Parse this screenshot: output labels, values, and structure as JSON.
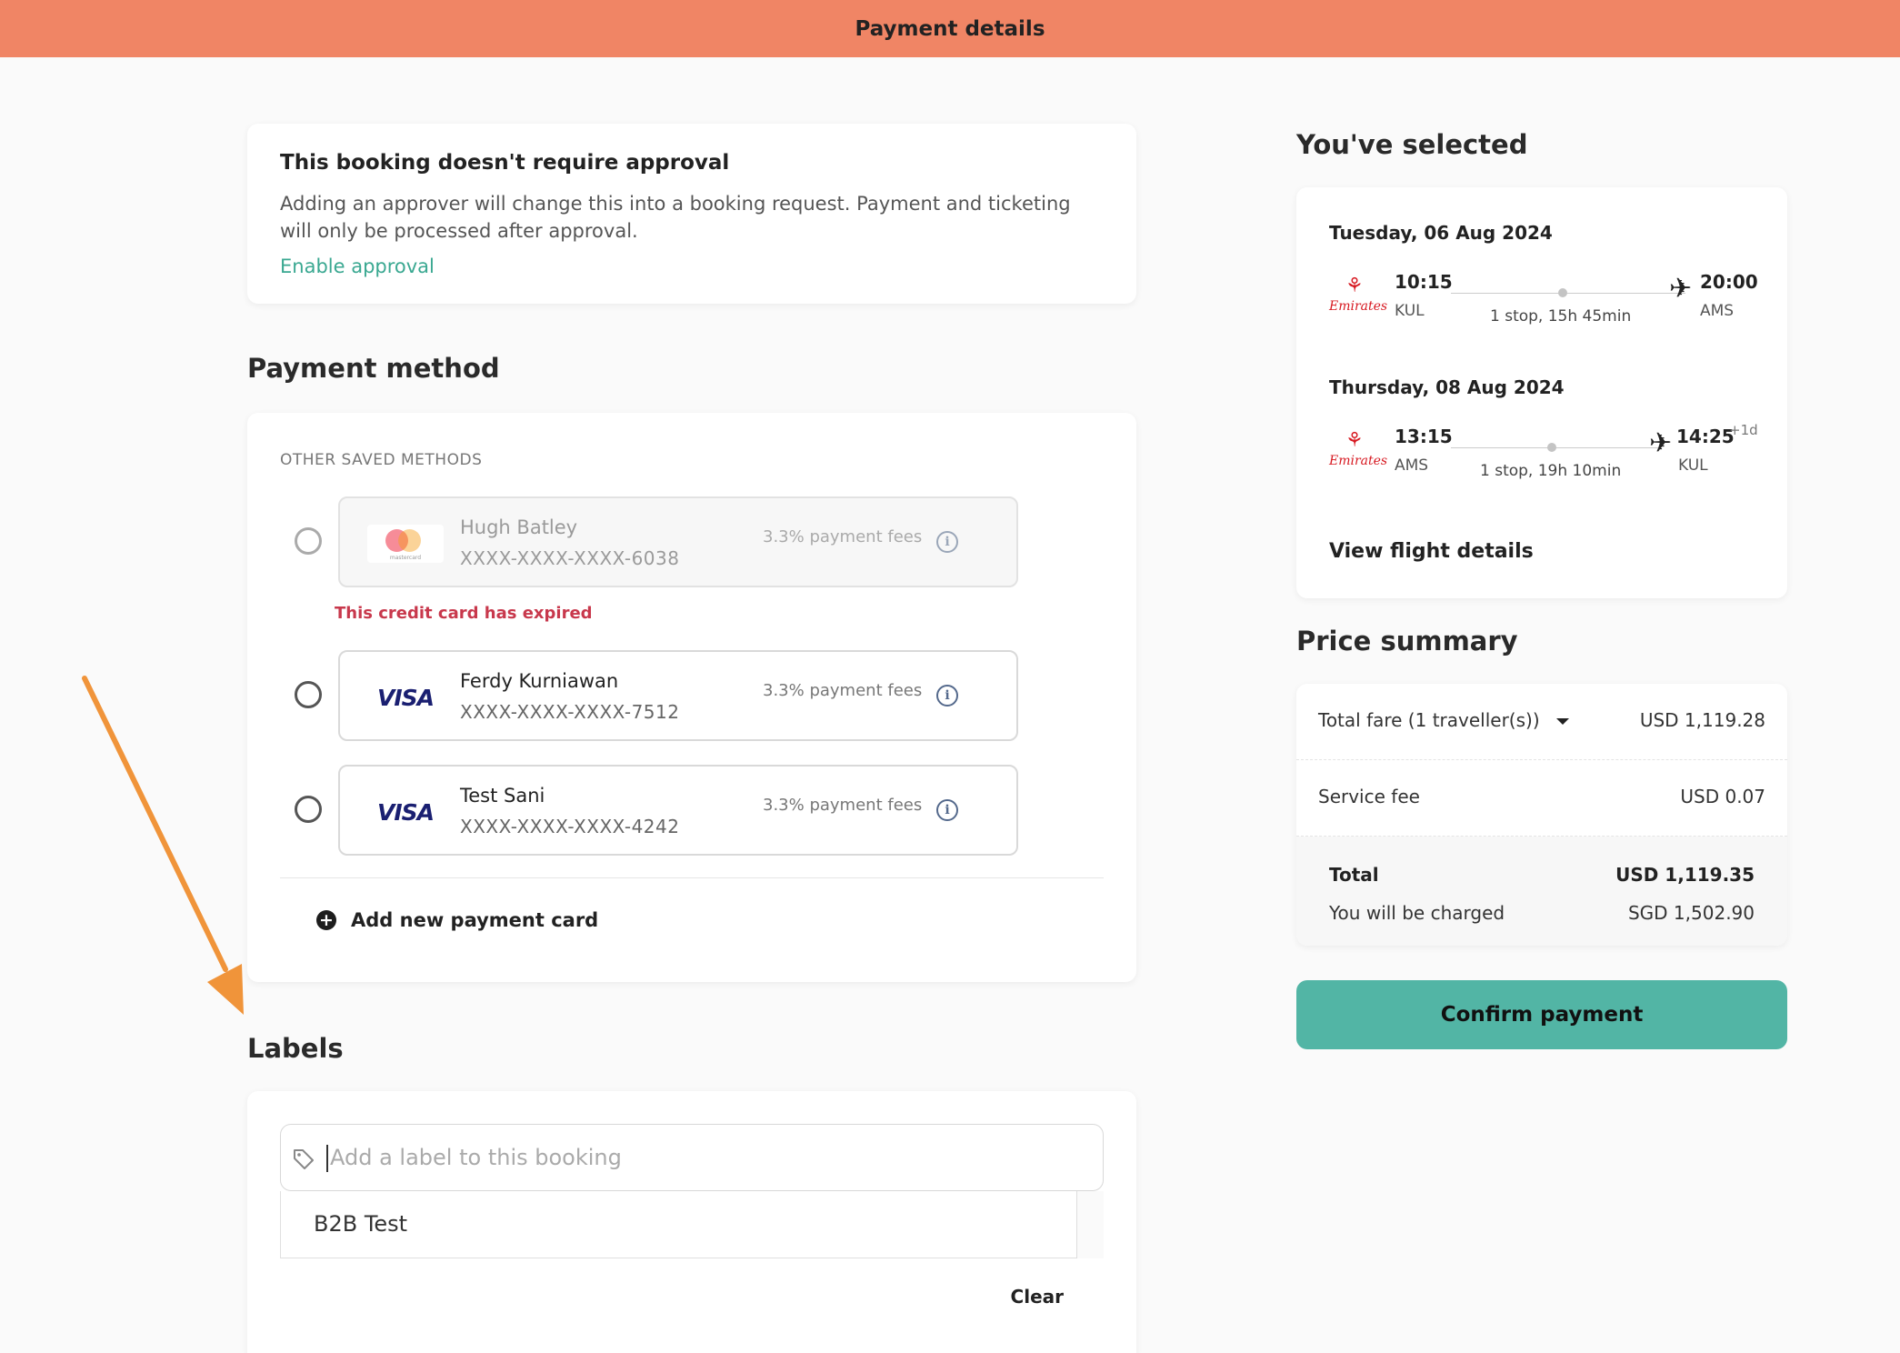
{
  "header": {
    "title": "Payment details"
  },
  "approval": {
    "title": "This booking doesn't require approval",
    "description": "Adding an approver will change this into a booking request. Payment and ticketing will only be processed after approval.",
    "link": "Enable approval"
  },
  "payment": {
    "section_title": "Payment method",
    "saved_label": "OTHER SAVED METHODS",
    "cards": [
      {
        "brand": "mastercard",
        "brand_caption": "mastercard",
        "name": "Hugh Batley",
        "number": "XXXX-XXXX-XXXX-6038",
        "fee": "3.3% payment fees",
        "error": "This credit card has expired",
        "disabled": true
      },
      {
        "brand": "VISA",
        "name": "Ferdy Kurniawan",
        "number": "XXXX-XXXX-XXXX-7512",
        "fee": "3.3% payment fees"
      },
      {
        "brand": "VISA",
        "name": "Test Sani",
        "number": "XXXX-XXXX-XXXX-4242",
        "fee": "3.3% payment fees"
      }
    ],
    "add_card": "Add new payment card",
    "icons": {
      "info": "info-icon",
      "add": "plus-circle-icon"
    }
  },
  "labels": {
    "section_title": "Labels",
    "placeholder": "Add a label to this booking",
    "options": [
      "B2B Test"
    ],
    "clear": "Clear"
  },
  "selected": {
    "title": "You've selected",
    "flights": [
      {
        "date": "Tuesday, 06 Aug 2024",
        "airline": "Emirates",
        "dep_time": "10:15",
        "dep_airport": "KUL",
        "stops": "1 stop, 15h 45min",
        "arr_time": "20:00",
        "arr_airport": "AMS",
        "day_offset": ""
      },
      {
        "date": "Thursday, 08 Aug 2024",
        "airline": "Emirates",
        "dep_time": "13:15",
        "dep_airport": "AMS",
        "stops": "1 stop, 19h 10min",
        "arr_time": "14:25",
        "arr_airport": "KUL",
        "day_offset": "+1d"
      }
    ],
    "view_details": "View flight details"
  },
  "price": {
    "title": "Price summary",
    "total_fare_label": "Total fare (1 traveller(s))",
    "total_fare_value": "USD 1,119.28",
    "service_fee_label": "Service fee",
    "service_fee_value": "USD 0.07",
    "total_label": "Total",
    "total_value": "USD 1,119.35",
    "charged_label": "You will be charged",
    "charged_value": "SGD 1,502.90"
  },
  "confirm_button": "Confirm payment",
  "colors": {
    "header": "#f08565",
    "accent": "#52b5a5",
    "link": "#3aa891",
    "error": "#c8384c",
    "annotation_arrow": "#f0943a"
  }
}
